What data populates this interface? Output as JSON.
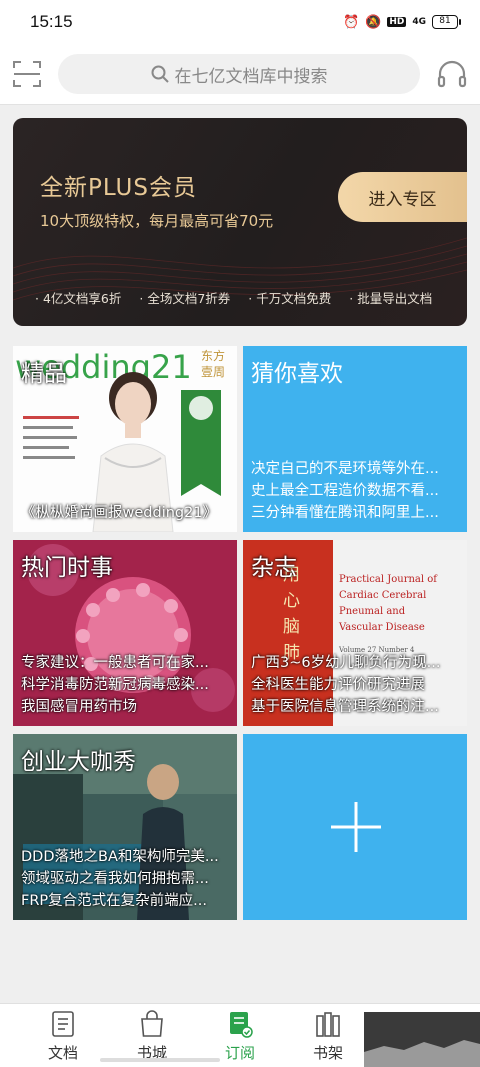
{
  "status_bar": {
    "time": "15:15",
    "battery": "81",
    "signal": "4G"
  },
  "top_bar": {
    "search_placeholder": "在七亿文档库中搜索"
  },
  "plus_banner": {
    "title": "全新PLUS会员",
    "subtitle": "10大顶级特权，每月最高可省70元",
    "enter_label": "进入专区",
    "features": [
      "4亿文档享6折",
      "全场文档7折券",
      "千万文档免费",
      "批量导出文档"
    ]
  },
  "tiles": [
    {
      "title": "精品",
      "lines": [
        "《枞枞婚尚画报wedding21》"
      ],
      "cover_text": "wedding21",
      "cover_side": "东方壹周"
    },
    {
      "title": "猜你喜欢",
      "lines": [
        "决定自己的不是环境等外在...",
        "史上最全工程造价数据不看...",
        "三分钟看懂在腾讯和阿里上..."
      ]
    },
    {
      "title": "热门时事",
      "lines": [
        "专家建议：一般患者可在家...",
        "科学消毒防范新冠病毒感染...",
        "我国感冒用药市场"
      ]
    },
    {
      "title": "杂志",
      "lines": [
        "广西3~6岁幼儿聊负行为现...",
        "全科医生能力评价研究进展",
        "基于医院信息管理系统的注..."
      ],
      "cover_lines": [
        "Practical Journal of",
        "Cardiac Cerebral",
        "Pneumal and",
        "Vascular Disease"
      ],
      "cover_vol": "Volume 27  Number 4"
    },
    {
      "title": "创业大咖秀",
      "lines": [
        "DDD落地之BA和架构师完美...",
        "领域驱动之看我如何拥抱需...",
        "FRP复合范式在复杂前端应..."
      ]
    },
    {
      "title": "",
      "lines": []
    }
  ],
  "tab_bar": {
    "items": [
      {
        "label": "文档",
        "icon": "document-icon"
      },
      {
        "label": "书城",
        "icon": "shopping-bag-icon"
      },
      {
        "label": "订阅",
        "icon": "subscription-icon"
      },
      {
        "label": "书架",
        "icon": "bookshelf-icon"
      }
    ],
    "active_color": "#2ba24c"
  },
  "colors": {
    "accent": "#2ba24c",
    "tile_blue": "#3fb2ee",
    "gold": "#e8c996"
  }
}
